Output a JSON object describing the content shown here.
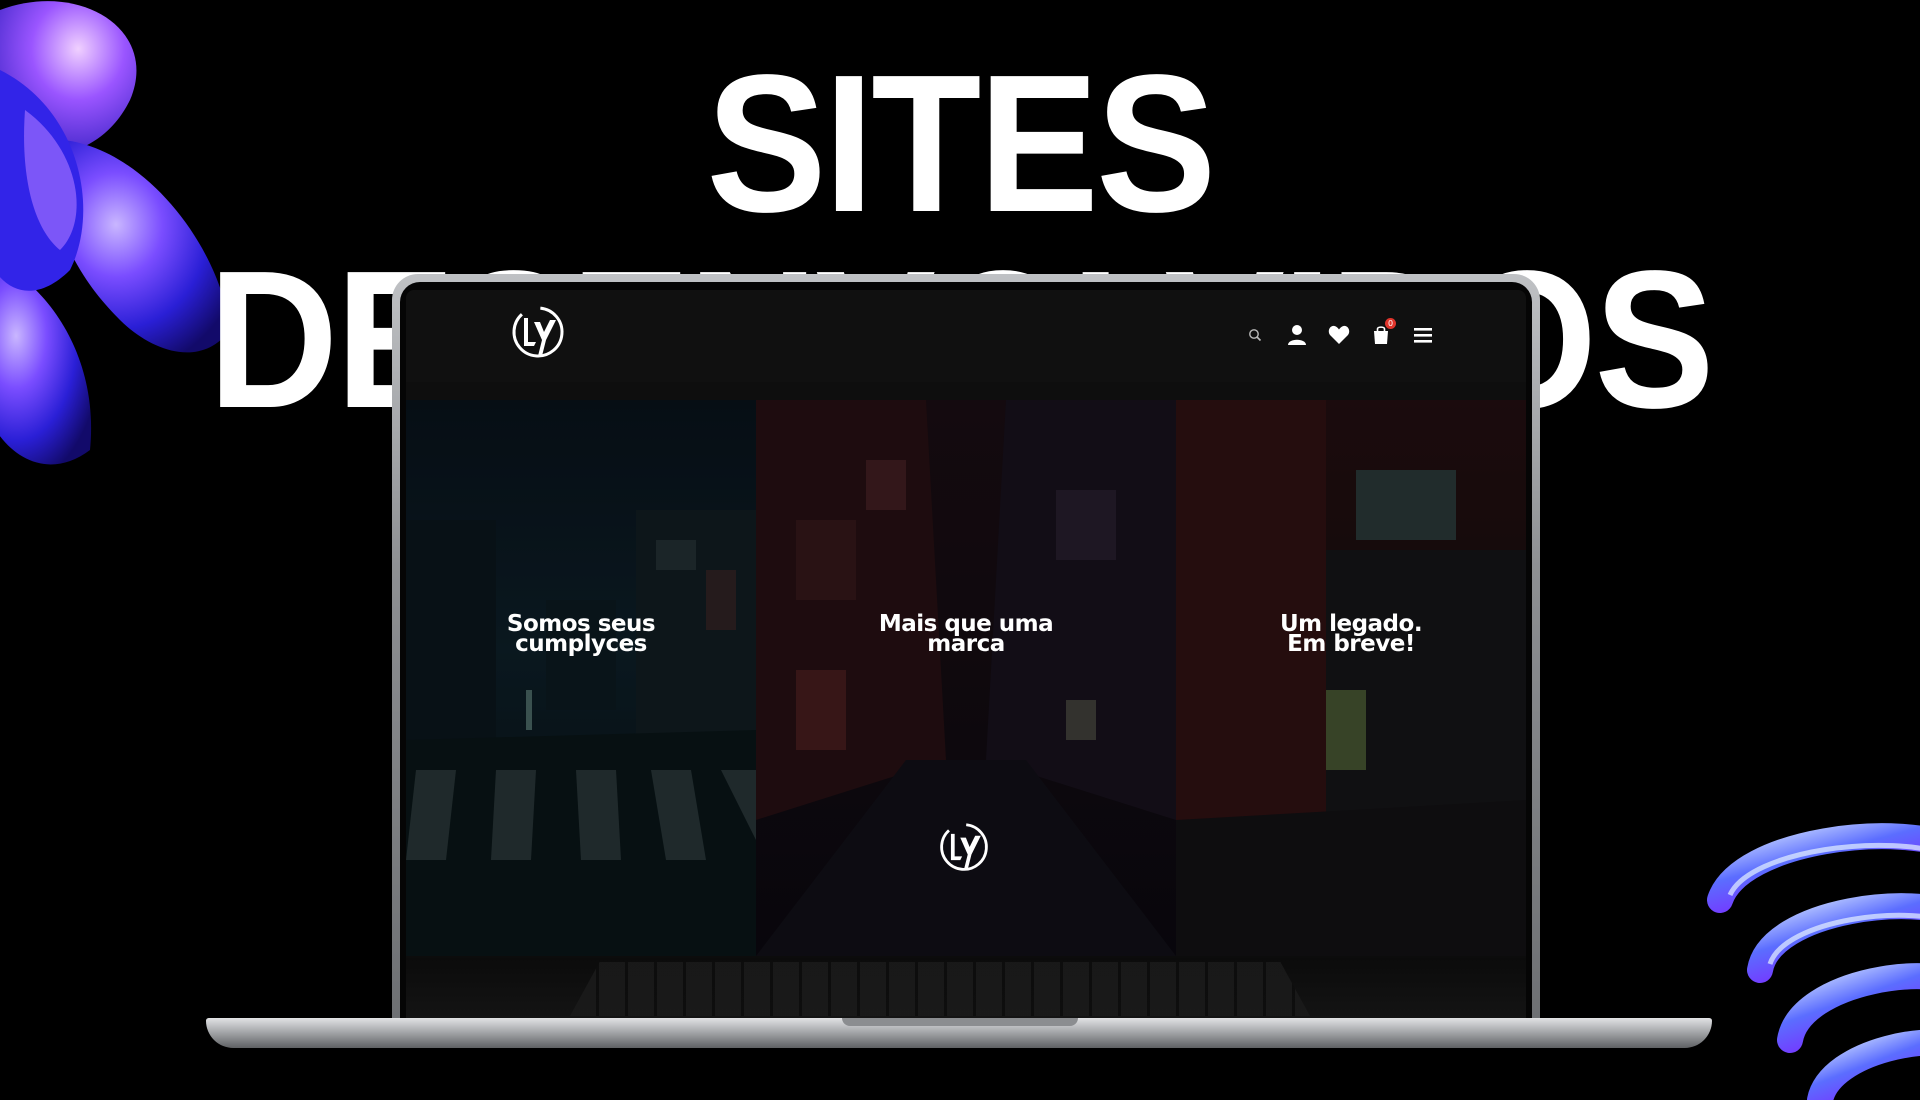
{
  "headline": "SITES DESENVOLVIDOS",
  "site": {
    "cart_count": "0",
    "icons": [
      "logo-icon",
      "search-icon",
      "user-icon",
      "heart-icon",
      "bag-icon",
      "menu-icon"
    ],
    "panels": [
      {
        "title": "Somos seus\ncumplyces"
      },
      {
        "title": "Mais que uma\nmarca"
      },
      {
        "title": "Um legado.\nEm breve!"
      }
    ]
  },
  "colors": {
    "background": "#000000",
    "accent_blue": "#3b35ff",
    "accent_purple": "#8e3cf0",
    "badge_red": "#e0342b"
  }
}
